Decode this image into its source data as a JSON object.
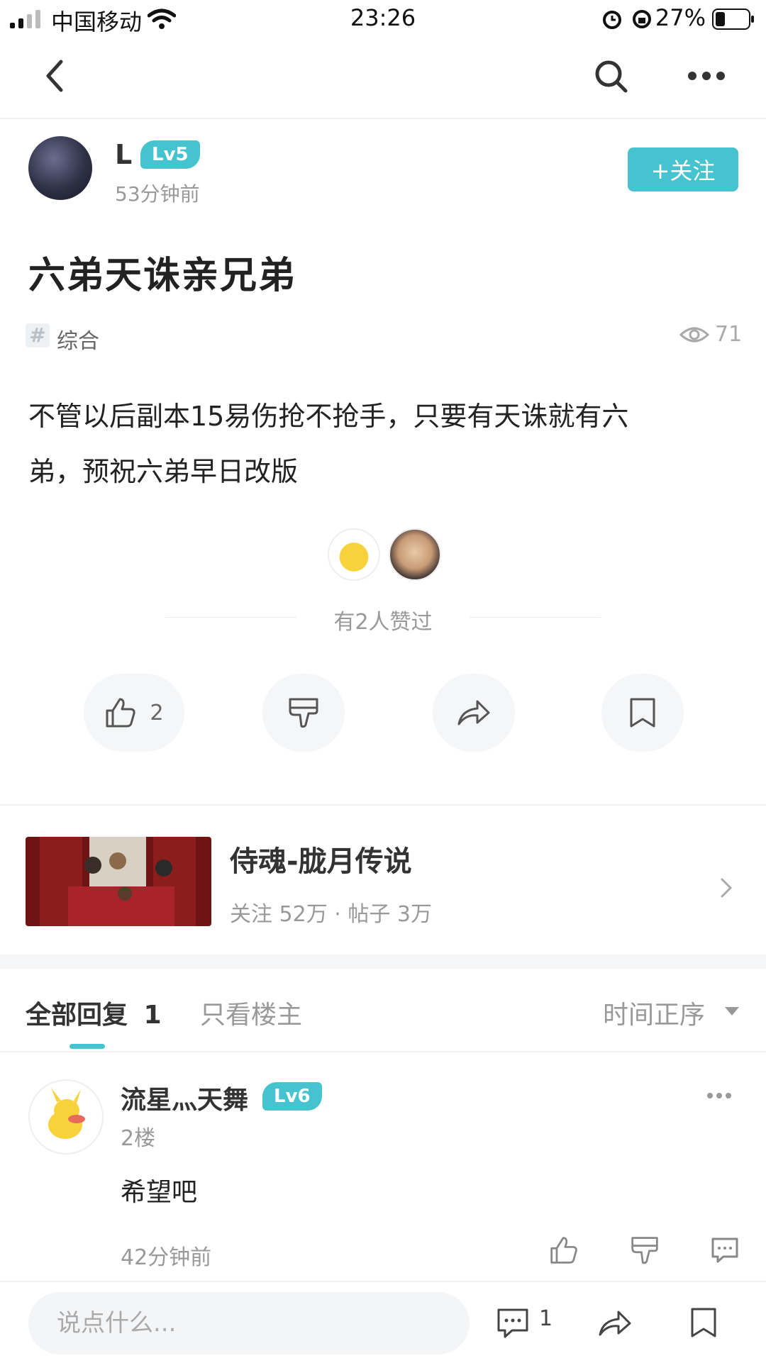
{
  "status_bar": {
    "carrier": "中国移动",
    "time": "23:26",
    "battery": "27%"
  },
  "author": {
    "name": "L",
    "level": "Lv5",
    "time_ago": "53分钟前",
    "follow_label": "+关注"
  },
  "post": {
    "title": "六弟天诛亲兄弟",
    "tag": "综合",
    "views": "71",
    "content_line1": "不管以后副本15易伤抢不抢手，只要有天诛就有六",
    "content_line2": "弟，预祝六弟早日改版"
  },
  "likes": {
    "text": "有2人赞过"
  },
  "actions": {
    "like_count": "2"
  },
  "forum": {
    "name": "侍魂-胧月传说",
    "stats": "关注 52万 · 帖子 3万"
  },
  "tabs": {
    "all_label": "全部回复",
    "all_count": "1",
    "owner_label": "只看楼主",
    "sort_label": "时间正序"
  },
  "comment": {
    "name": "流星灬天舞",
    "level": "Lv6",
    "floor": "2楼",
    "text": "希望吧",
    "time": "42分钟前"
  },
  "bottom": {
    "input_placeholder": "说点什么...",
    "comment_count": "1"
  },
  "colors": {
    "accent": "#45c3cf"
  }
}
